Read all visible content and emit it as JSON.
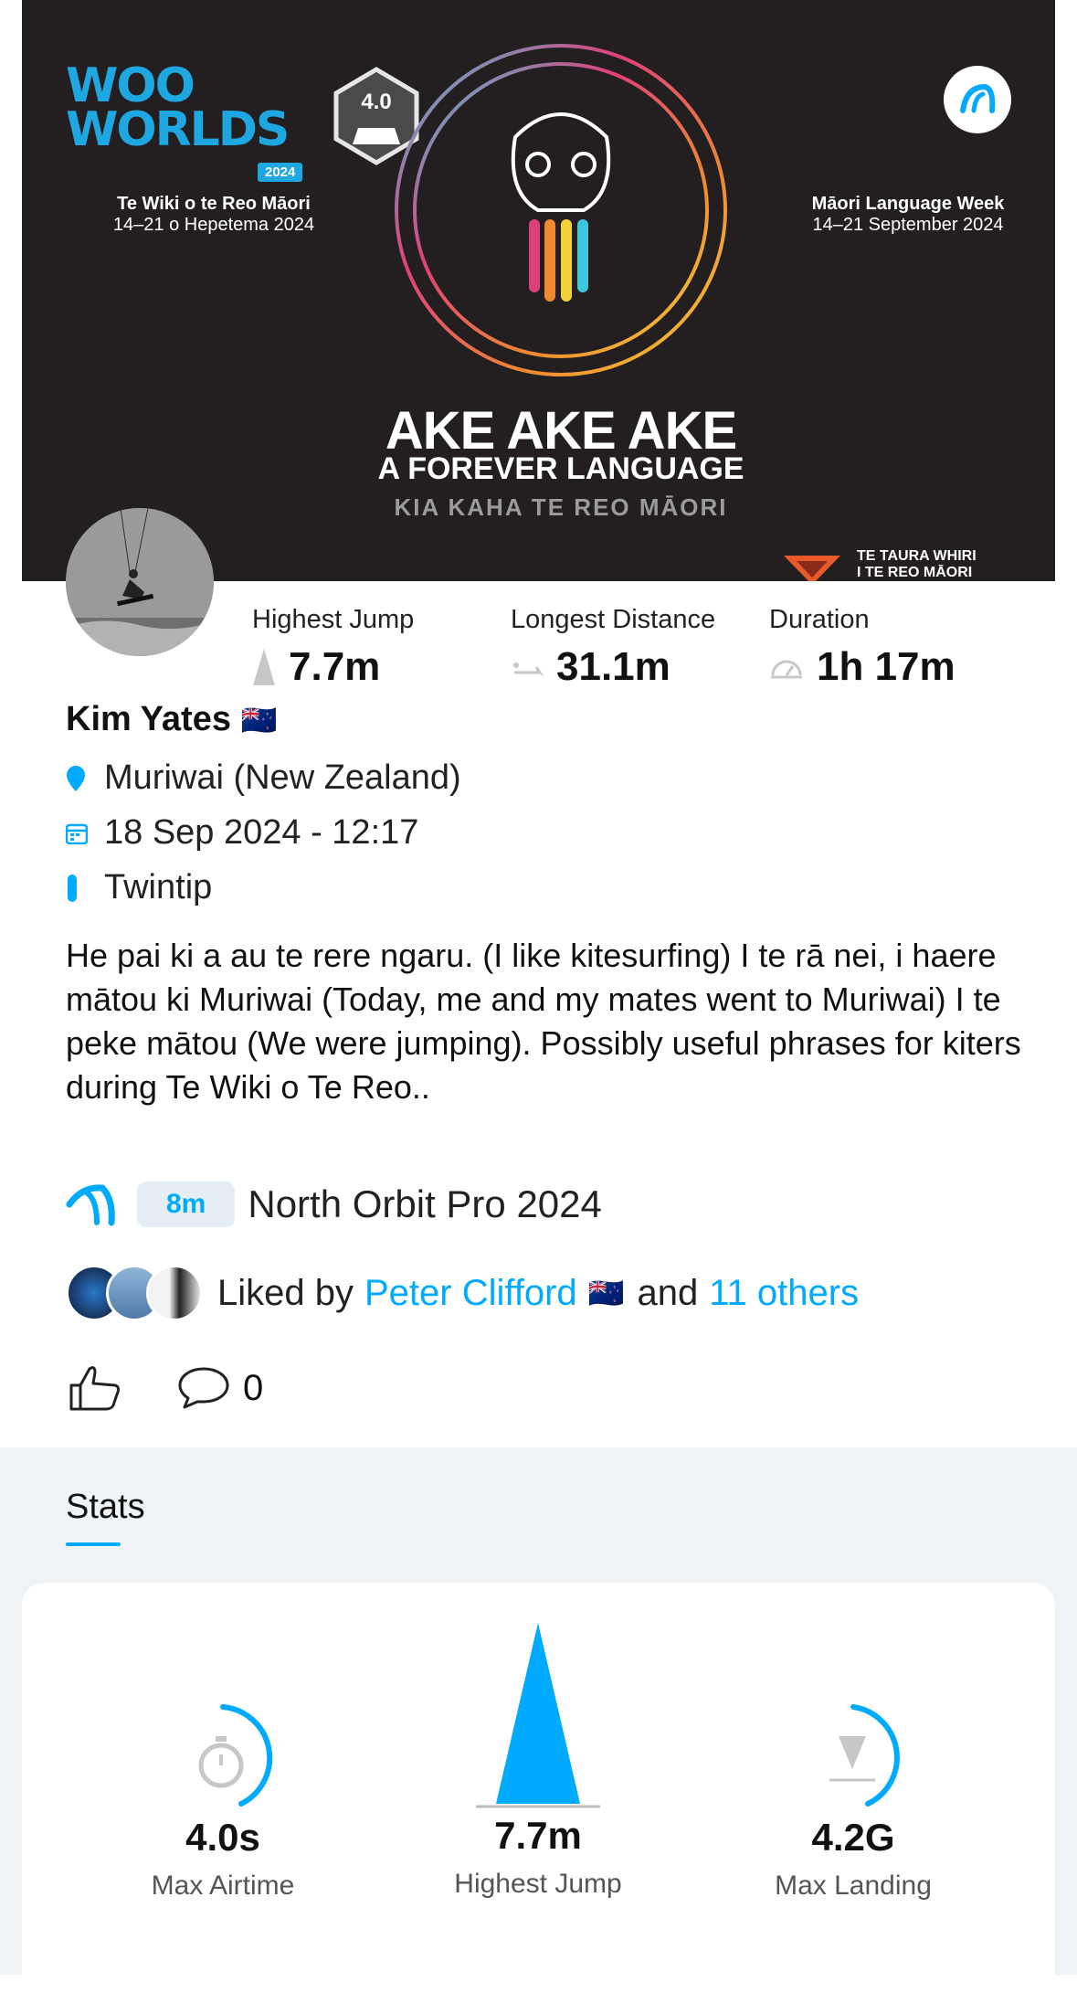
{
  "banner": {
    "logo_line1": "WOO",
    "logo_line2": "WORLDS",
    "logo_year": "2024",
    "level_badge": "4.0",
    "left_event_title": "Te Wiki o te Reo Māori",
    "left_event_date": "14–21 o Hepetema 2024",
    "right_event_title": "Māori Language Week",
    "right_event_date": "14–21 September 2024",
    "headline": "AKE AKE AKE",
    "subheadline": "A FOREVER LANGUAGE",
    "tagline": "KIA KAHA TE REO MĀORI",
    "org_line1": "TE TAURA WHIRI",
    "org_line2": "I TE REO MĀORI"
  },
  "top_stats": [
    {
      "label": "Highest Jump",
      "value": "7.7m",
      "icon": "jump-icon"
    },
    {
      "label": "Longest Distance",
      "value": "31.1m",
      "icon": "distance-icon"
    },
    {
      "label": "Duration",
      "value": "1h 17m",
      "icon": "duration-icon"
    }
  ],
  "session": {
    "user_name": "Kim Yates",
    "flag": "🇳🇿",
    "location": "Muriwai (New Zealand)",
    "datetime": "18 Sep 2024 - 12:17",
    "board": "Twintip",
    "description": "He pai ki a au te rere ngaru. (I like kitesurfing) I te rā nei, i haere mātou ki Muriwai (Today, me and my mates went to Muriwai) I te peke mātou (We were jumping). Possibly useful phrases for kiters during Te Wiki o Te Reo.."
  },
  "kite": {
    "size": "8m",
    "name": "North Orbit Pro 2024"
  },
  "likes": {
    "prefix": "Liked by",
    "first_liker": "Peter Clifford",
    "flag": "🇳🇿",
    "joiner": "and",
    "others": "11 others"
  },
  "actions": {
    "comment_count": "0"
  },
  "stats_section": {
    "tab_label": "Stats",
    "items": [
      {
        "value": "4.0s",
        "label": "Max Airtime"
      },
      {
        "value": "7.7m",
        "label": "Highest Jump"
      },
      {
        "value": "4.2G",
        "label": "Max Landing"
      }
    ]
  },
  "colors": {
    "accent": "#00aaff",
    "banner_bg": "#231f20",
    "stats_bg": "#f0f3f5"
  }
}
